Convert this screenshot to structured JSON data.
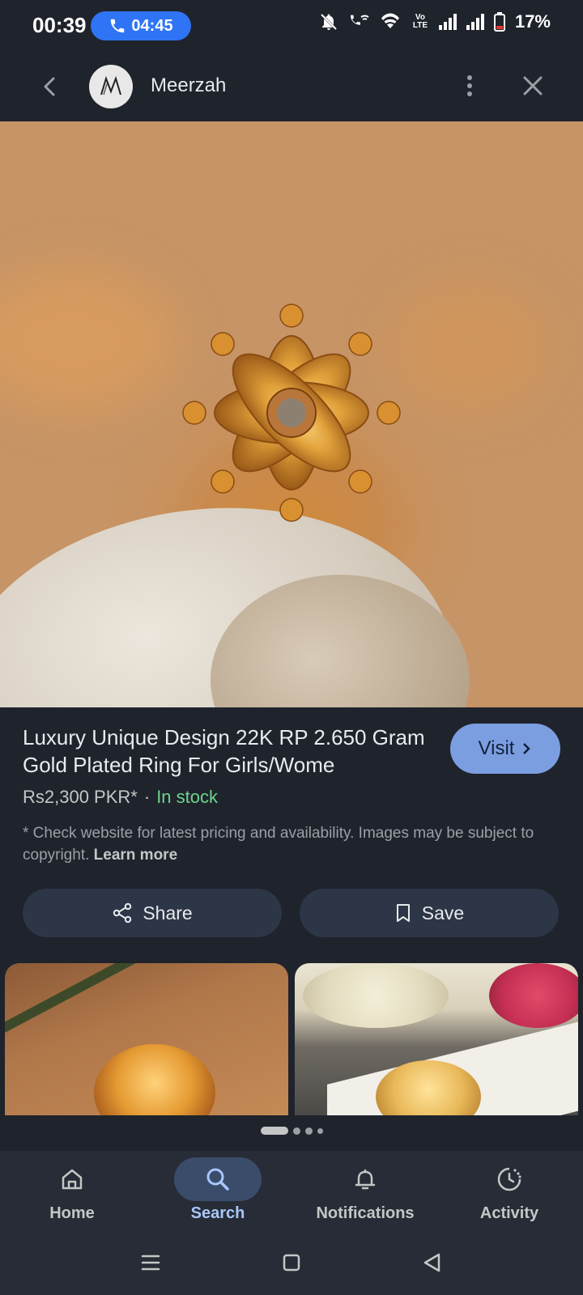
{
  "status_bar": {
    "time": "00:39",
    "call_timer": "04:45",
    "battery": "17%",
    "icons": [
      "mute-icon",
      "wifi-call-icon",
      "wifi-icon",
      "volte-icon",
      "signal-icon",
      "signal-icon",
      "battery-icon"
    ],
    "call_pill_color": "#2f74f4",
    "volte_text": "Vo LTE"
  },
  "top_bar": {
    "title": "Meerzah",
    "avatar_monogram": "M"
  },
  "product": {
    "title": "Luxury Unique Design 22K RP 2.650 Gram Gold Plated Ring For Girls/Wome",
    "price": "Rs2,300 PKR*",
    "separator": "·",
    "stock": "In stock",
    "stock_color": "#6dd58c",
    "visit_label": "Visit",
    "disclaimer": "* Check website for latest pricing and availability. Images may be subject to copyright.",
    "learn_more": "Learn more"
  },
  "actions": {
    "share_label": "Share",
    "save_label": "Save"
  },
  "bottom_nav": {
    "items": [
      {
        "label": "Home",
        "icon": "home-icon"
      },
      {
        "label": "Search",
        "icon": "search-icon",
        "active": true
      },
      {
        "label": "Notifications",
        "icon": "bell-icon"
      },
      {
        "label": "Activity",
        "icon": "activity-icon"
      }
    ],
    "active_color": "#a8c7fa"
  },
  "system_nav": [
    "menu-icon",
    "home-square-icon",
    "back-triangle-icon"
  ],
  "carousel": {
    "pages": 4,
    "active_index": 0
  }
}
